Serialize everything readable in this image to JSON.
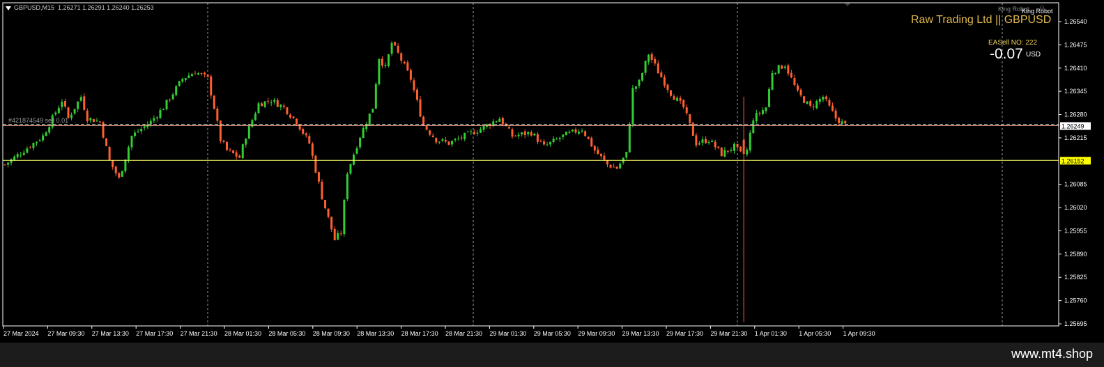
{
  "header": {
    "symbol": "GBPUSD,M15",
    "ohlc": "1.26271 1.26291 1.26240 1.26253"
  },
  "robot": {
    "title_faded": "King Robot",
    "title": "King Robot"
  },
  "broker_label": "Raw Trading Ltd || GBPUSD",
  "ea": {
    "label": "EASell NO: 222",
    "profit": "-0.07",
    "currency": "USD"
  },
  "order_line_label": "#421874549 sell 0.01",
  "watermark": "www.mt4.shop",
  "colors": {
    "background": "#000000",
    "bull": "#32cd32",
    "bear": "#ff6030",
    "grid": "#9a9a9a",
    "axis": "#ffffff",
    "price_marker": "#ffffff",
    "order_line": "#ffff66",
    "order_line_bg": "#ffff00",
    "current_line": "#ffb090"
  },
  "chart_data": {
    "type": "candlestick",
    "y_ticks": [
      "1.26540",
      "1.26475",
      "1.26410",
      "1.26345",
      "1.26280",
      "1.26215",
      "1.26085",
      "1.26020",
      "1.25955",
      "1.25890",
      "1.25825",
      "1.25760",
      "1.25695"
    ],
    "y_range": [
      1.25695,
      1.2654
    ],
    "x_ticks": [
      "27 Mar 2024",
      "27 Mar 09:30",
      "27 Mar 13:30",
      "27 Mar 17:30",
      "27 Mar 21:30",
      "28 Mar 01:30",
      "28 Mar 05:30",
      "28 Mar 09:30",
      "28 Mar 13:30",
      "28 Mar 17:30",
      "28 Mar 21:30",
      "29 Mar 01:30",
      "29 Mar 05:30",
      "29 Mar 09:30",
      "29 Mar 13:30",
      "29 Mar 17:30",
      "29 Mar 21:30",
      "1 Apr 01:30",
      "1 Apr 05:30",
      "1 Apr 09:30"
    ],
    "current_price": "1.26249",
    "order_price": "1.26152",
    "anchors": [
      [
        0,
        1.2614
      ],
      [
        6,
        1.2618
      ],
      [
        12,
        1.2622
      ],
      [
        18,
        1.2632
      ],
      [
        20,
        1.2627
      ],
      [
        24,
        1.2633
      ],
      [
        26,
        1.2627
      ],
      [
        30,
        1.2626
      ],
      [
        33,
        1.2615
      ],
      [
        36,
        1.261
      ],
      [
        40,
        1.2622
      ],
      [
        46,
        1.2626
      ],
      [
        50,
        1.263
      ],
      [
        56,
        1.2638
      ],
      [
        60,
        1.264
      ],
      [
        64,
        1.2638
      ],
      [
        66,
        1.263
      ],
      [
        68,
        1.2621
      ],
      [
        70,
        1.2618
      ],
      [
        74,
        1.2616
      ],
      [
        76,
        1.2622
      ],
      [
        80,
        1.2631
      ],
      [
        84,
        1.2632
      ],
      [
        88,
        1.263
      ],
      [
        92,
        1.2626
      ],
      [
        96,
        1.262
      ],
      [
        100,
        1.2605
      ],
      [
        104,
        1.2593
      ],
      [
        106,
        1.2595
      ],
      [
        108,
        1.2612
      ],
      [
        112,
        1.2622
      ],
      [
        116,
        1.263
      ],
      [
        118,
        1.2644
      ],
      [
        120,
        1.2641
      ],
      [
        122,
        1.2648
      ],
      [
        124,
        1.2645
      ],
      [
        128,
        1.2638
      ],
      [
        132,
        1.2625
      ],
      [
        136,
        1.2621
      ],
      [
        140,
        1.262
      ],
      [
        150,
        1.2624
      ],
      [
        156,
        1.2627
      ],
      [
        160,
        1.2622
      ],
      [
        166,
        1.2623
      ],
      [
        170,
        1.2619
      ],
      [
        176,
        1.2622
      ],
      [
        182,
        1.2624
      ],
      [
        186,
        1.2618
      ],
      [
        190,
        1.2614
      ],
      [
        193,
        1.2613
      ],
      [
        196,
        1.2617
      ],
      [
        198,
        1.2635
      ],
      [
        200,
        1.2637
      ],
      [
        203,
        1.2645
      ],
      [
        206,
        1.264
      ],
      [
        210,
        1.2634
      ],
      [
        214,
        1.263
      ],
      [
        218,
        1.262
      ],
      [
        222,
        1.2621
      ],
      [
        226,
        1.2617
      ],
      [
        230,
        1.2619
      ],
      [
        233,
        1.2616
      ],
      [
        234,
        1.2618
      ],
      [
        236,
        1.2627
      ],
      [
        240,
        1.263
      ],
      [
        242,
        1.264
      ],
      [
        246,
        1.2642
      ],
      [
        250,
        1.2634
      ],
      [
        254,
        1.263
      ],
      [
        258,
        1.2633
      ],
      [
        262,
        1.2627
      ],
      [
        265,
        1.2625
      ]
    ]
  }
}
